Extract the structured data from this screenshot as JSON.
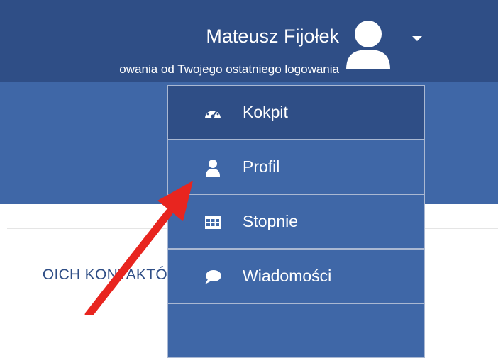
{
  "header": {
    "user_name": "Mateusz Fijołek",
    "login_info": "owania od Twojego ostatniego logowania",
    "avatar_icon": "user-avatar-icon",
    "caret_icon": "caret-down-icon"
  },
  "content": {
    "contacts_heading": "OICH KONTAKTÓ"
  },
  "dropdown": {
    "items": [
      {
        "label": "Kokpit",
        "icon": "dashboard-icon",
        "active": true
      },
      {
        "label": "Profil",
        "icon": "user-icon",
        "active": false
      },
      {
        "label": "Stopnie",
        "icon": "table-icon",
        "active": false
      },
      {
        "label": "Wiadomości",
        "icon": "comment-icon",
        "active": false
      },
      {
        "label": "",
        "icon": "",
        "active": false
      }
    ]
  },
  "colors": {
    "header_bg": "#2f4e86",
    "band_bg": "#3f67a7",
    "menu_active_bg": "#2f4e86",
    "menu_item_bg": "#3f67a7",
    "annotation_arrow": "#e8251f"
  }
}
